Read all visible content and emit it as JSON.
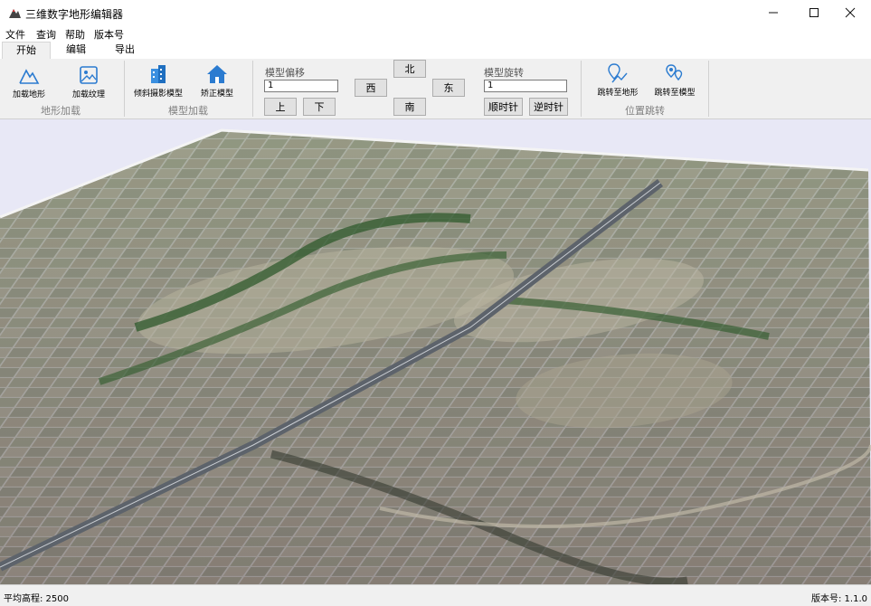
{
  "window": {
    "title": "三维数字地形编辑器",
    "minimize_icon": "minimize-icon",
    "maximize_icon": "maximize-icon",
    "close_icon": "close-icon"
  },
  "menu": [
    "文件",
    "查询",
    "帮助",
    "版本号"
  ],
  "tabs": [
    {
      "label": "开始",
      "active": true
    },
    {
      "label": "编辑",
      "active": false
    },
    {
      "label": "导出",
      "active": false
    }
  ],
  "ribbon": {
    "terrain_group": {
      "label": "地形加载",
      "load_terrain": {
        "label": "加载地形",
        "icon": "terrain-icon"
      },
      "load_texture": {
        "label": "加载纹理",
        "icon": "image-icon"
      }
    },
    "model_group": {
      "label": "模型加载",
      "oblique_model": {
        "label": "倾斜摄影模型",
        "icon": "buildings-icon"
      },
      "regular_model": {
        "label": "矫正模型",
        "icon": "house-icon"
      }
    },
    "offset_group": {
      "caption": "模型偏移",
      "value": "1",
      "up": "上",
      "down": "下",
      "north": "北",
      "south": "南",
      "west": "西",
      "east": "东"
    },
    "rotate_group": {
      "caption": "模型旋转",
      "value": "1",
      "clockwise": "顺时针",
      "counterclockwise": "逆时针"
    },
    "jump_group": {
      "label": "位置跳转",
      "to_terrain": {
        "label": "跳转至地形",
        "icon": "map-pin-icon"
      },
      "to_model": {
        "label": "跳转至模型",
        "icon": "location-icon"
      }
    }
  },
  "colors": {
    "accent": "#2b7bd0",
    "viewport_bg": "#e8e8f6"
  },
  "status": {
    "avg_elevation": "平均高程: 2500",
    "version": "版本号: 1.1.0"
  }
}
